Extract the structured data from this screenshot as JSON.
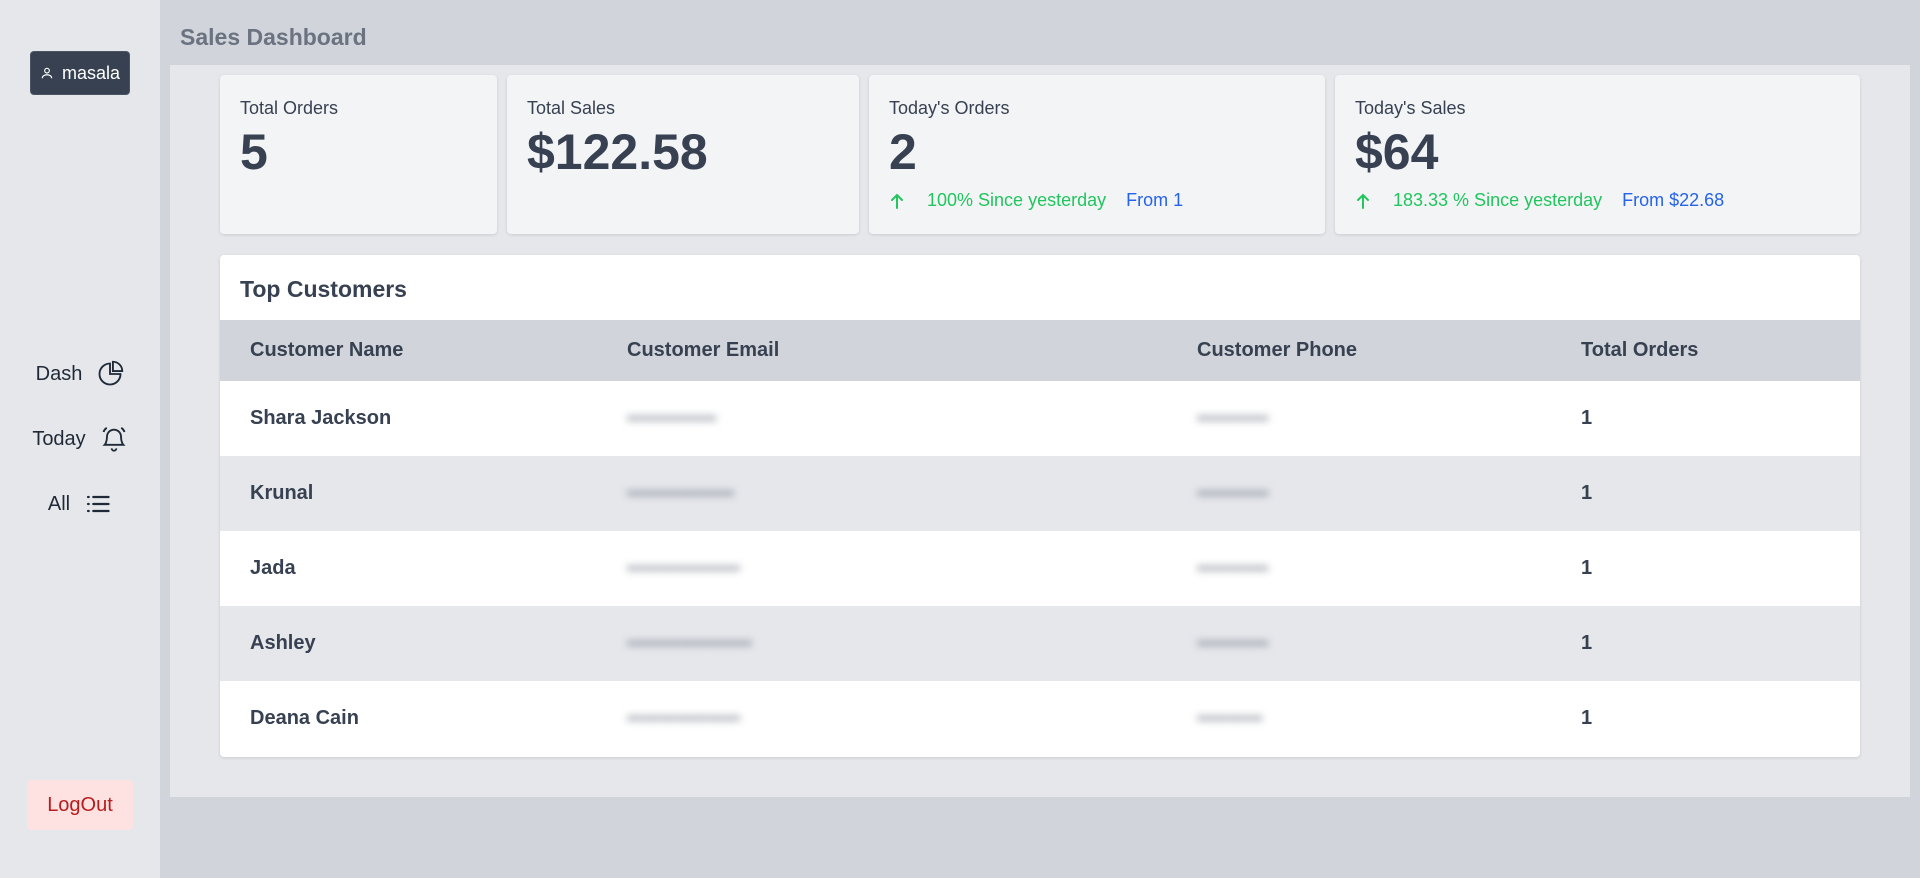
{
  "page_title": "Sales Dashboard",
  "user": {
    "name": "masala",
    "icon": "user-icon"
  },
  "nav": [
    {
      "label": "Dash",
      "icon": "pie-chart-icon"
    },
    {
      "label": "Today",
      "icon": "bell-icon"
    },
    {
      "label": "All",
      "icon": "list-icon"
    }
  ],
  "logout_label": "LogOut",
  "stats": [
    {
      "label": "Total Orders",
      "value": "5"
    },
    {
      "label": "Total Sales",
      "value": "$122.58"
    },
    {
      "label": "Today's Orders",
      "value": "2",
      "change": "100% Since yesterday",
      "from": "From 1"
    },
    {
      "label": "Today's Sales",
      "value": "$64",
      "change": "183.33 % Since yesterday",
      "from": "From $22.68"
    }
  ],
  "top_customers": {
    "title": "Top Customers",
    "columns": [
      "Customer Name",
      "Customer Email",
      "Customer Phone",
      "Total Orders"
    ],
    "rows": [
      {
        "name": "Shara Jackson",
        "email": "",
        "phone": "",
        "orders": "1"
      },
      {
        "name": "Krunal",
        "email": "",
        "phone": "",
        "orders": "1"
      },
      {
        "name": "Jada",
        "email": "",
        "phone": "",
        "orders": "1"
      },
      {
        "name": "Ashley",
        "email": "",
        "phone": "",
        "orders": "1"
      },
      {
        "name": "Deana Cain",
        "email": "",
        "phone": "",
        "orders": "1"
      }
    ]
  },
  "colors": {
    "positive": "#22c55e",
    "link": "#2563eb",
    "logout_bg": "#fee2e2",
    "logout_text": "#b91c1c",
    "user_badge_bg": "#374151"
  }
}
